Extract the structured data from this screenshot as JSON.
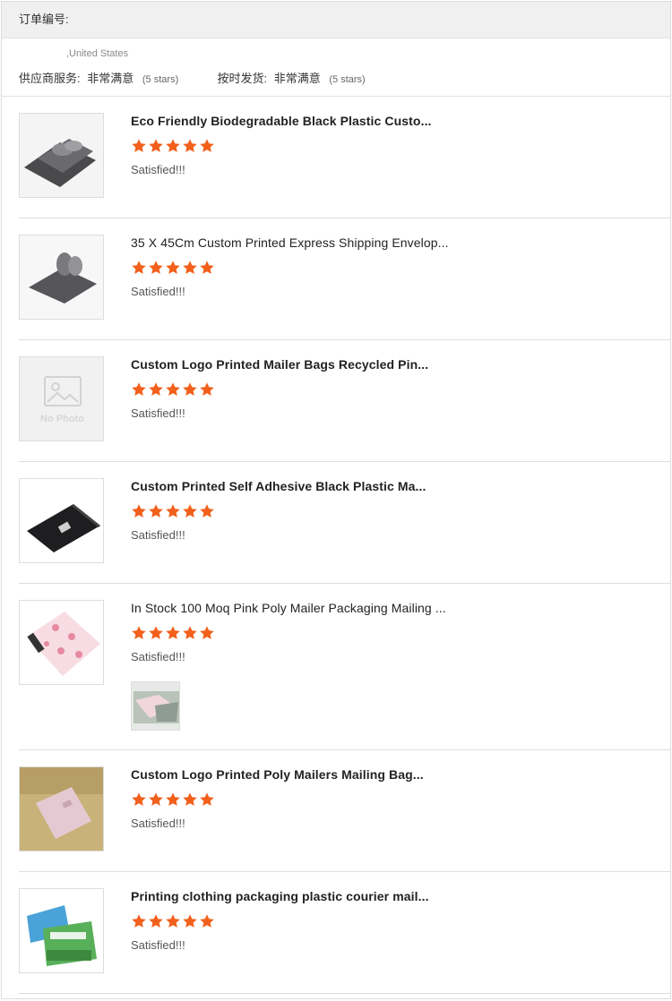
{
  "header": {
    "order_label": "订单编号:"
  },
  "buyer": {
    "country": ",United States"
  },
  "supplier_rating": {
    "label": "供应商服务:",
    "value": "非常满意",
    "stars": "(5 stars)"
  },
  "delivery_rating": {
    "label": "按时发货:",
    "value": "非常满意",
    "stars": "(5 stars)"
  },
  "colors": {
    "star": "#f2601b",
    "border": "#dddddd",
    "header_bg": "#f0f0f0"
  },
  "items": [
    {
      "title": "Eco Friendly Biodegradable Black Plastic Custo...",
      "rating": 5,
      "comment": "Satisfied!!!",
      "image": "gray-mailer-bags-photo"
    },
    {
      "title": "35 X 45Cm Custom Printed Express Shipping Envelop...",
      "rating": 5,
      "comment": "Satisfied!!!",
      "image": "gray-mailer-bags-photo"
    },
    {
      "title": "Custom Logo Printed Mailer Bags Recycled Pin...",
      "rating": 5,
      "comment": "Satisfied!!!",
      "image": "no-photo-placeholder",
      "no_photo_text": "No Photo"
    },
    {
      "title": "Custom Printed Self Adhesive Black Plastic Ma...",
      "rating": 5,
      "comment": "Satisfied!!!",
      "image": "black-mailer-bag-photo"
    },
    {
      "title": "In Stock 100 Moq Pink Poly Mailer Packaging Mailing ...",
      "rating": 5,
      "comment": "Satisfied!!!",
      "image": "pink-flamingo-mailer-photo",
      "review_photo": "review-photo-mailer-bags"
    },
    {
      "title": "Custom Logo Printed Poly Mailers Mailing Bag...",
      "rating": 5,
      "comment": "Satisfied!!!",
      "image": "pink-mailer-on-sofa-photo"
    },
    {
      "title": "Printing clothing packaging plastic courier mail...",
      "rating": 5,
      "comment": "Satisfied!!!",
      "image": "biodegradable-mailer-bags-photo"
    }
  ]
}
